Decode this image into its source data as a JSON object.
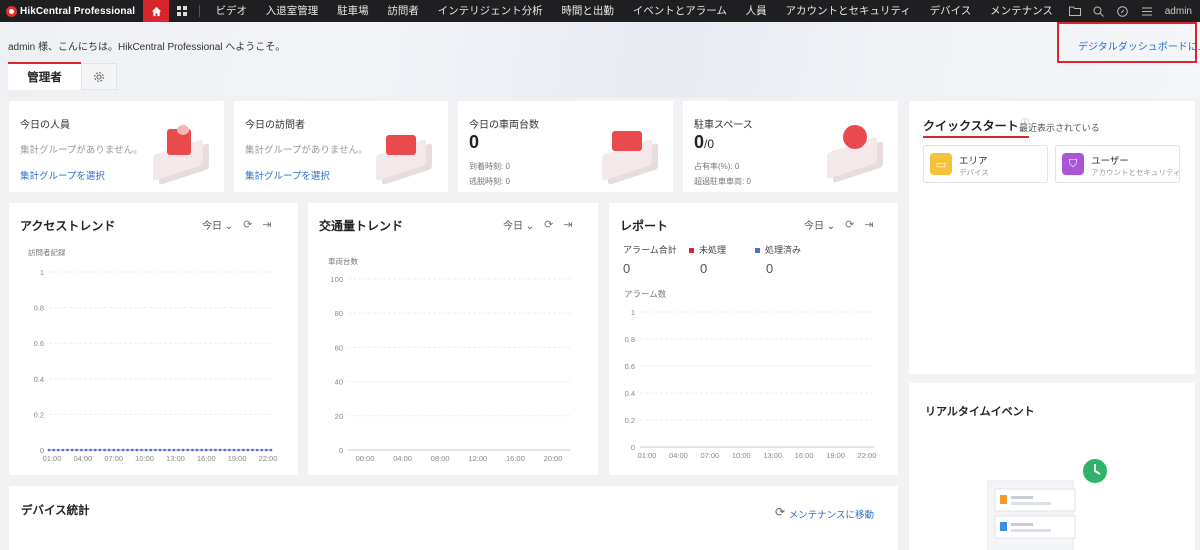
{
  "nav": {
    "brand": "HikCentral Professional",
    "items": [
      "ビデオ",
      "入退室管理",
      "駐車場",
      "訪問者",
      "インテリジェント分析",
      "時間と出勤",
      "イベントとアラーム",
      "人員",
      "アカウントとセキュリティ",
      "デバイス",
      "メンテナンス"
    ],
    "user": "admin"
  },
  "banner": {
    "welcome": "admin 様、こんにちは。HikCentral Professional へようこそ。",
    "dashboard_link": "デジタルダッシュボードに...",
    "tab_admin": "管理者"
  },
  "stats": {
    "people": {
      "title": "今日の人員",
      "empty": "集計グループがありません。",
      "link": "集計グループを選択"
    },
    "visitors": {
      "title": "今日の訪問者",
      "empty": "集計グループがありません。",
      "link": "集計グループを選択"
    },
    "vehicles": {
      "title": "今日の車両台数",
      "value": "0",
      "arrivals": "到着時刻: 0",
      "departures": "逃脱時刻: 0"
    },
    "parking": {
      "title": "駐車スペース",
      "value": "0",
      "total": "/0",
      "occupancy": "占有率(%): 0",
      "overtime": "超過駐車車両: 0"
    }
  },
  "access_trend": {
    "title": "アクセストレンド",
    "period": "今日",
    "ylabel": "訪問者記録",
    "chart_data": {
      "type": "line",
      "x": [
        "01:00",
        "04:00",
        "07:00",
        "10:00",
        "13:00",
        "16:00",
        "19:00",
        "22:00"
      ],
      "ylabel": "訪問者記録",
      "yticks": [
        "1",
        "0.8",
        "0.6",
        "0.4",
        "0.2",
        "0"
      ],
      "ylim": [
        0,
        1
      ],
      "series": [
        {
          "values": [
            0,
            0,
            0,
            0,
            0,
            0,
            0,
            0
          ]
        }
      ]
    }
  },
  "traffic_trend": {
    "title": "交通量トレンド",
    "period": "今日",
    "ylabel": "車両台数",
    "chart_data": {
      "type": "line",
      "x": [
        "00:00",
        "04:00",
        "08:00",
        "12:00",
        "16:00",
        "20:00"
      ],
      "ylabel": "車両台数",
      "yticks": [
        "100",
        "80",
        "60",
        "40",
        "20",
        "0"
      ],
      "ylim": [
        0,
        100
      ],
      "series": []
    }
  },
  "report": {
    "title": "レポート",
    "period": "今日",
    "alarm_total_label": "アラーム合計",
    "alarm_total": "0",
    "unhandled_label": "未処理",
    "unhandled": "0",
    "handled_label": "処理済み",
    "handled": "0",
    "ylabel": "アラーム数",
    "colors": {
      "unhandled": "#d9252e",
      "handled": "#4a6fd8"
    },
    "chart_data": {
      "type": "line",
      "x": [
        "01:00",
        "04:00",
        "07:00",
        "10:00",
        "13:00",
        "16:00",
        "19:00",
        "22:00"
      ],
      "ylabel": "アラーム数",
      "yticks": [
        "1",
        "0.8",
        "0.6",
        "0.4",
        "0.2",
        "0"
      ],
      "ylim": [
        0,
        1
      ],
      "series": []
    }
  },
  "quickstart": {
    "title": "クイックスタート",
    "subtitle": "最近表示されている",
    "tiles": [
      {
        "name": "エリア",
        "desc": "デバイス",
        "color": "#f5c33b",
        "icon": "area-icon"
      },
      {
        "name": "ユーザー",
        "desc": "アカウントとセキュリティ",
        "color": "#a855d8",
        "icon": "user-shield-icon"
      }
    ]
  },
  "realtime": {
    "title": "リアルタイムイベント"
  },
  "devices": {
    "title": "デバイス統計",
    "link": "メンテナンスに移動"
  }
}
